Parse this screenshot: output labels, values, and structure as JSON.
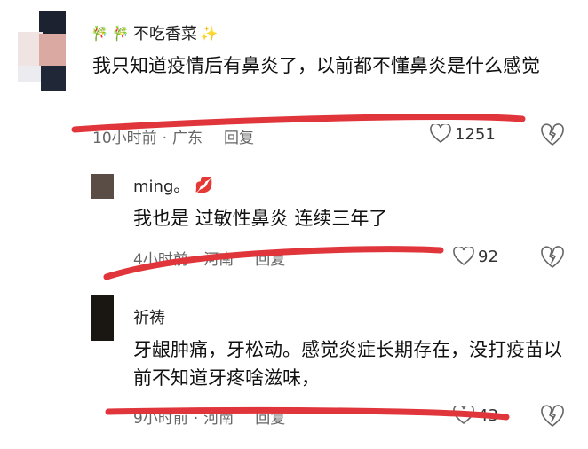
{
  "comments": [
    {
      "username": "不吃香菜",
      "text": "我只知道疫情后有鼻炎了，以前都不懂鼻炎是什么感觉",
      "time": "10小时前",
      "location": "广东",
      "reply": "回复",
      "likes": "1251"
    },
    {
      "username": "ming。",
      "text": "我也是 过敏性鼻炎 连续三年了",
      "time": "4小时前",
      "location": "河南",
      "reply": "回复",
      "likes": "92"
    },
    {
      "username": "祈祷",
      "text": "牙龈肿痛，牙松动。感觉炎症长期存在，没打疫苗以前不知道牙疼啥滋味，",
      "time": "9小时前",
      "location": "河南",
      "reply": "回复",
      "likes": "43"
    }
  ],
  "colors": {
    "scribble": "#e0353a",
    "meta": "#666666"
  },
  "icons": {
    "like": "heart-outline-icon",
    "dislike": "broken-heart-icon"
  }
}
